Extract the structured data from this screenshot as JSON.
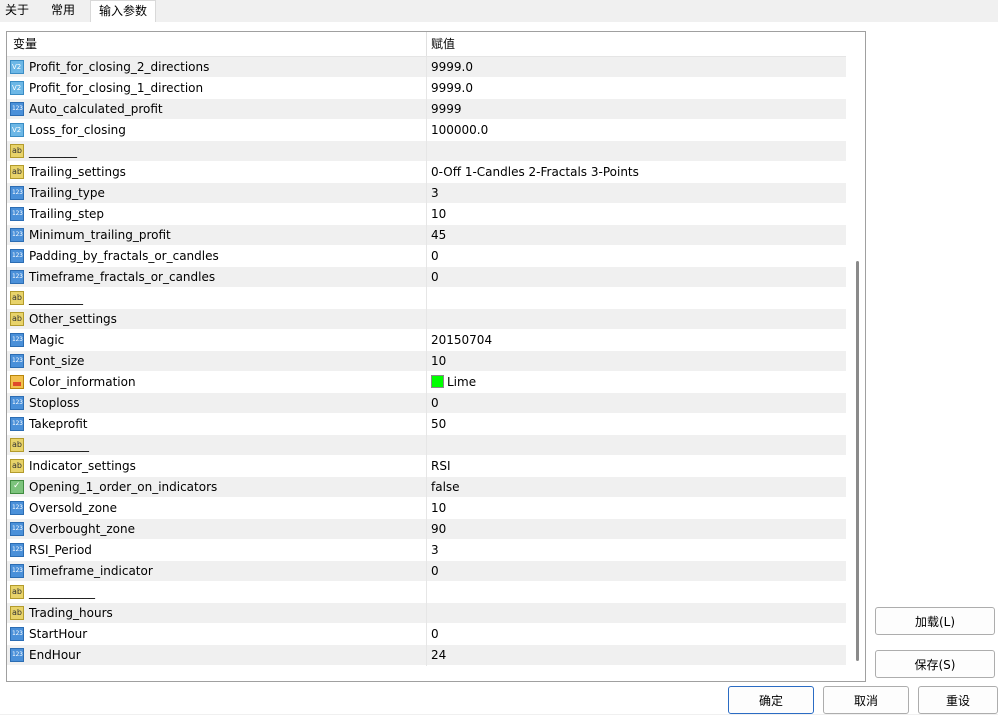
{
  "tabs": [
    {
      "label": "关于",
      "active": false
    },
    {
      "label": "常用",
      "active": false
    },
    {
      "label": "输入参数",
      "active": true
    }
  ],
  "table": {
    "col_variable": "变量",
    "col_value": "赋值",
    "rows": [
      {
        "icon": "dbl",
        "name": "Profit_for_closing_2_directions",
        "value": "9999.0"
      },
      {
        "icon": "dbl",
        "name": "Profit_for_closing_1_direction",
        "value": "9999.0"
      },
      {
        "icon": "num",
        "name": "Auto_calculated_profit",
        "value": "9999"
      },
      {
        "icon": "dbl",
        "name": "Loss_for_closing",
        "value": "100000.0"
      },
      {
        "icon": "str",
        "name": "________",
        "value": ""
      },
      {
        "icon": "str",
        "name": "Trailing_settings",
        "value": "0-Off  1-Candles  2-Fractals  3-Points"
      },
      {
        "icon": "num",
        "name": "Trailing_type",
        "value": "3"
      },
      {
        "icon": "num",
        "name": "Trailing_step",
        "value": "10"
      },
      {
        "icon": "num",
        "name": "Minimum_trailing_profit",
        "value": "45"
      },
      {
        "icon": "num",
        "name": "Padding_by_fractals_or_candles",
        "value": "0"
      },
      {
        "icon": "num",
        "name": "Timeframe_fractals_or_candles",
        "value": "0"
      },
      {
        "icon": "str",
        "name": "_________",
        "value": ""
      },
      {
        "icon": "str",
        "name": "Other_settings",
        "value": ""
      },
      {
        "icon": "num",
        "name": "Magic",
        "value": "20150704"
      },
      {
        "icon": "num",
        "name": "Font_size",
        "value": "10"
      },
      {
        "icon": "color",
        "name": "Color_information",
        "value": "Lime",
        "swatch": "#00ff00"
      },
      {
        "icon": "num",
        "name": "Stoploss",
        "value": "0"
      },
      {
        "icon": "num",
        "name": "Takeprofit",
        "value": "50"
      },
      {
        "icon": "str",
        "name": "__________",
        "value": ""
      },
      {
        "icon": "str",
        "name": "Indicator_settings",
        "value": "RSI"
      },
      {
        "icon": "bool",
        "name": "Opening_1_order_on_indicators",
        "value": "false"
      },
      {
        "icon": "num",
        "name": "Oversold_zone",
        "value": "10"
      },
      {
        "icon": "num",
        "name": "Overbought_zone",
        "value": "90"
      },
      {
        "icon": "num",
        "name": "RSI_Period",
        "value": "3"
      },
      {
        "icon": "num",
        "name": "Timeframe_indicator",
        "value": "0"
      },
      {
        "icon": "str",
        "name": "___________",
        "value": ""
      },
      {
        "icon": "str",
        "name": "Trading_hours",
        "value": ""
      },
      {
        "icon": "num",
        "name": "StartHour",
        "value": "0"
      },
      {
        "icon": "num",
        "name": "EndHour",
        "value": "24"
      }
    ]
  },
  "buttons": {
    "load": "加载(L)",
    "save": "保存(S)",
    "ok": "确定",
    "cancel": "取消",
    "reset": "重设"
  },
  "colors": {
    "default_button_border": "#2b6cc4",
    "alt_row": "#f0f0f0"
  }
}
